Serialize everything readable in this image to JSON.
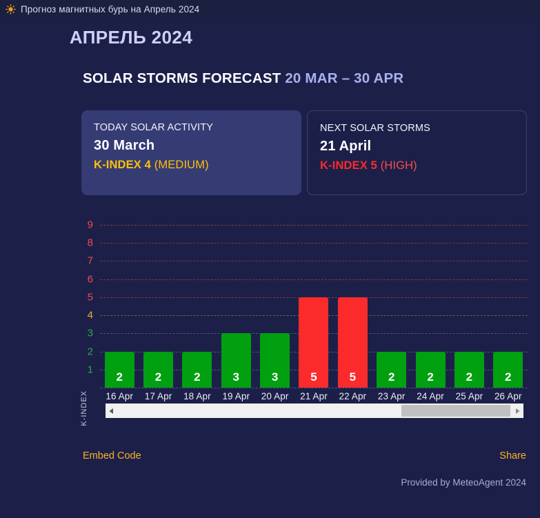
{
  "topbar": {
    "icon": "sun-icon",
    "title": "Прогноз магнитных бурь на Апрель 2024"
  },
  "month_title": "АПРЕЛЬ 2024",
  "forecast": {
    "heading": "SOLAR STORMS FORECAST",
    "range": "20 MAR – 30 APR"
  },
  "cards": [
    {
      "label": "TODAY SOLAR ACTIVITY",
      "date": "30 March",
      "kindex_text": "K-INDEX 4",
      "level_text": "(MEDIUM)",
      "level": "medium",
      "color": "#ffc107"
    },
    {
      "label": "NEXT SOLAR STORMS",
      "date": "21 April",
      "kindex_text": "K-INDEX 5",
      "level_text": "(HIGH)",
      "level": "high",
      "color": "#fb2b2b"
    }
  ],
  "chart_data": {
    "type": "bar",
    "title": "",
    "xlabel": "",
    "ylabel": "K-INDEX",
    "ylim": [
      0,
      9.6
    ],
    "grid": true,
    "legend": "none",
    "categories": [
      "16 Apr",
      "17 Apr",
      "18 Apr",
      "19 Apr",
      "20 Apr",
      "21 Apr",
      "22 Apr",
      "23 Apr",
      "24 Apr",
      "25 Apr",
      "26 Apr"
    ],
    "values": [
      2,
      2,
      2,
      3,
      3,
      5,
      5,
      2,
      2,
      2,
      2
    ],
    "bar_colors": [
      "#00a010",
      "#00a010",
      "#00a010",
      "#00a010",
      "#00a010",
      "#fb2b2b",
      "#fb2b2b",
      "#00a010",
      "#00a010",
      "#00a010",
      "#00a010"
    ],
    "yticks": [
      9,
      8,
      7,
      6,
      5,
      4,
      3,
      2,
      1
    ],
    "ytick_colors": [
      "#f04a4a",
      "#f04a4a",
      "#f04a4a",
      "#f04a4a",
      "#f04a4a",
      "#e8b52c",
      "#2aa845",
      "#2aa845",
      "#2aa845"
    ],
    "gridline_colors": [
      "#7a3a42",
      "#7a3a42",
      "#7a3a42",
      "#7a3a42",
      "#7a3a42",
      "#6e6236",
      "#4c5284",
      "#4c5284",
      "#4c5284"
    ]
  },
  "scrollbar": {
    "left_arrow": "chevron-left-icon",
    "right_arrow": "chevron-right-icon",
    "thumb_position": "right"
  },
  "footer": {
    "embed_code": "Embed Code",
    "share": "Share",
    "provided_by": "Provided by MeteoAgent 2024"
  }
}
